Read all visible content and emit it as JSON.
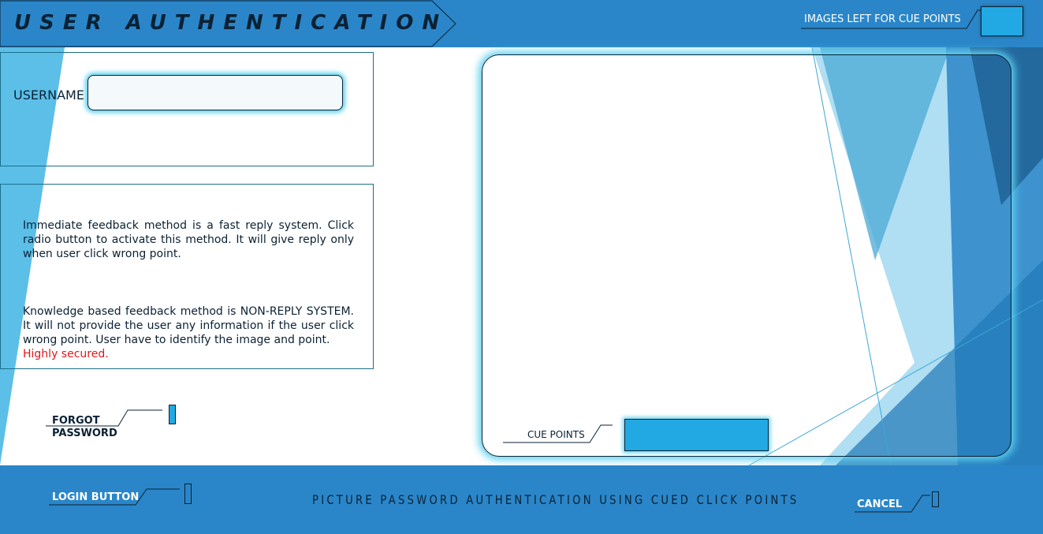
{
  "header": {
    "title": "USER AUTHENTICATION",
    "images_left_label": "IMAGES LEFT FOR CUE POINTS"
  },
  "login_form": {
    "username_label": "USERNAME",
    "username_value": ""
  },
  "info": {
    "immediate_feedback": "Immediate feedback method is a fast reply system. Click radio button to activate this method. It will give reply only when user click wrong point.",
    "knowledge_feedback": "Knowledge based feedback method is NON-REPLY SYSTEM. It will not provide the user any information if the user click wrong point. User  have to identify the image and point.",
    "secured_note": "Highly secured."
  },
  "forgot": {
    "label_line1": "FORGOT",
    "label_line2": "PASSWORD"
  },
  "cue_panel": {
    "cue_points_label": "CUE POINTS"
  },
  "footer": {
    "login_label": "LOGIN  BUTTON",
    "caption": "PICTURE PASSWORD AUTHENTICATION USING CUED CLICK POINTS",
    "cancel_label": "CANCEL"
  },
  "colors": {
    "bar_blue": "#2a86c8",
    "accent_cyan": "#22a9e3",
    "glow": "#5fd2f0",
    "dark_text": "#0b2134",
    "alert_red": "#e0161c"
  }
}
